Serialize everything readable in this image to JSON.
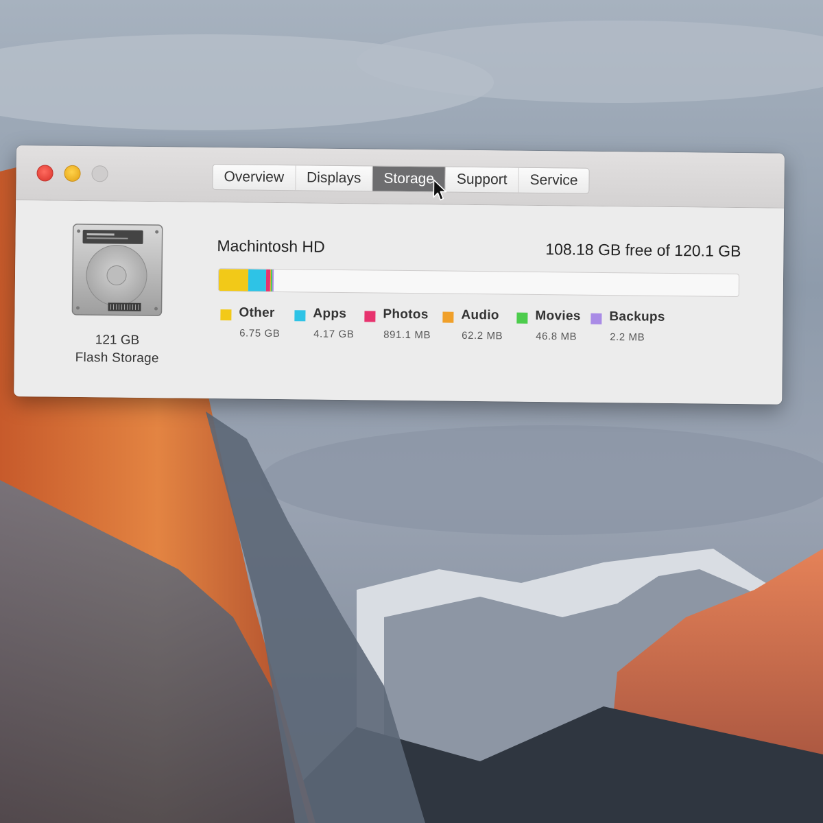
{
  "window": {
    "tabs": [
      {
        "label": "Overview"
      },
      {
        "label": "Displays"
      },
      {
        "label": "Storage"
      },
      {
        "label": "Support"
      },
      {
        "label": "Service"
      }
    ],
    "active_tab": "Storage"
  },
  "disk": {
    "size": "121 GB",
    "type": "Flash Storage",
    "icon": "hard-drive-icon"
  },
  "volume": {
    "name": "Machintosh HD",
    "free_text": "108.18 GB free of 120.1 GB",
    "total_gb": 120.1
  },
  "categories": [
    {
      "name": "Other",
      "size": "6.75 GB",
      "gb": 6.75,
      "color": "#f2c918"
    },
    {
      "name": "Apps",
      "size": "4.17 GB",
      "gb": 4.17,
      "color": "#2ec3e6"
    },
    {
      "name": "Photos",
      "size": "891.1 MB",
      "gb": 0.891,
      "color": "#e7336e"
    },
    {
      "name": "Audio",
      "size": "62.2 MB",
      "gb": 0.0622,
      "color": "#f0a02a"
    },
    {
      "name": "Movies",
      "size": "46.8 MB",
      "gb": 0.0468,
      "color": "#4ccc4c"
    },
    {
      "name": "Backups",
      "size": "2.2 MB",
      "gb": 0.0022,
      "color": "#a98be6"
    }
  ],
  "traffic_lights": {
    "close": "close-icon",
    "minimize": "minimize-icon",
    "zoom": "zoom-icon"
  }
}
